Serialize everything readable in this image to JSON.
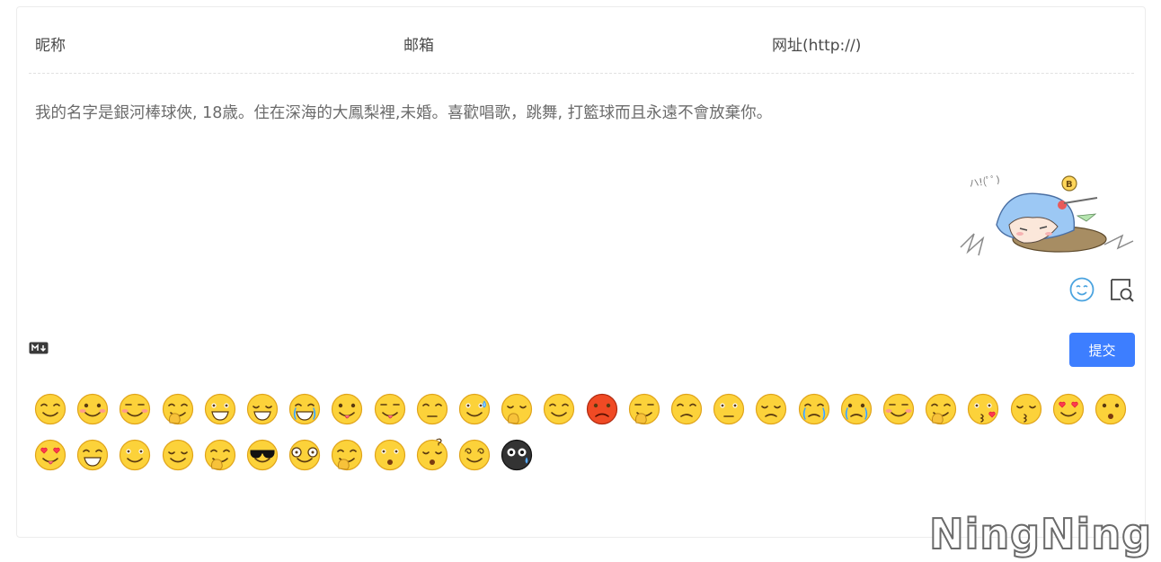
{
  "form": {
    "nick_placeholder": "昵称",
    "mail_placeholder": "邮箱",
    "link_placeholder": "网址(http://)"
  },
  "editor": {
    "content": "我的名字是銀河棒球俠, 18歳。住在深海的大鳳梨裡,未婚。喜歡唱歌，跳舞, 打籃球而且永遠不會放棄你。"
  },
  "toolbar": {
    "emoji_icon": "smiley-face-icon",
    "preview_icon": "preview-search-icon",
    "markdown_icon": "markdown-icon",
    "submit_label": "提交"
  },
  "colors": {
    "accent": "#3d7eff",
    "emoji_yellow": "#fcd23a",
    "emoji_outline": "#e0a41a"
  },
  "emojis": [
    "smile-emoji-icon",
    "blush-emoji-icon",
    "shy-emoji-icon",
    "cover-face-emoji-icon",
    "grin-emoji-icon",
    "laugh-emoji-icon",
    "tears-of-joy-emoji-icon",
    "tongue-emoji-icon",
    "yum-emoji-icon",
    "unamused-emoji-icon",
    "sweat-emoji-icon",
    "shush-emoji-icon",
    "smug-emoji-icon",
    "angry-emoji-icon",
    "hand-over-mouth-emoji-icon",
    "pleading-emoji-icon",
    "blank-emoji-icon",
    "sad-emoji-icon",
    "crying-emoji-icon",
    "sob-emoji-icon",
    "content-emoji-icon",
    "facepalm-emoji-icon",
    "kiss-heart-emoji-icon",
    "kiss-emoji-icon",
    "heart-eyes-drool-emoji-icon",
    "shocked-emoji-icon",
    "heart-eyes-tongue-emoji-icon",
    "big-grin-emoji-icon",
    "smirk-emoji-icon",
    "relieved-emoji-icon",
    "yawn-emoji-icon",
    "sunglasses-emoji-icon",
    "glasses-emoji-icon",
    "thinking-emoji-icon",
    "confused-emoji-icon",
    "dizzy-question-emoji-icon",
    "spiral-eyes-emoji-icon",
    "black-sweat-emoji-icon"
  ],
  "watermark": "NingNing"
}
